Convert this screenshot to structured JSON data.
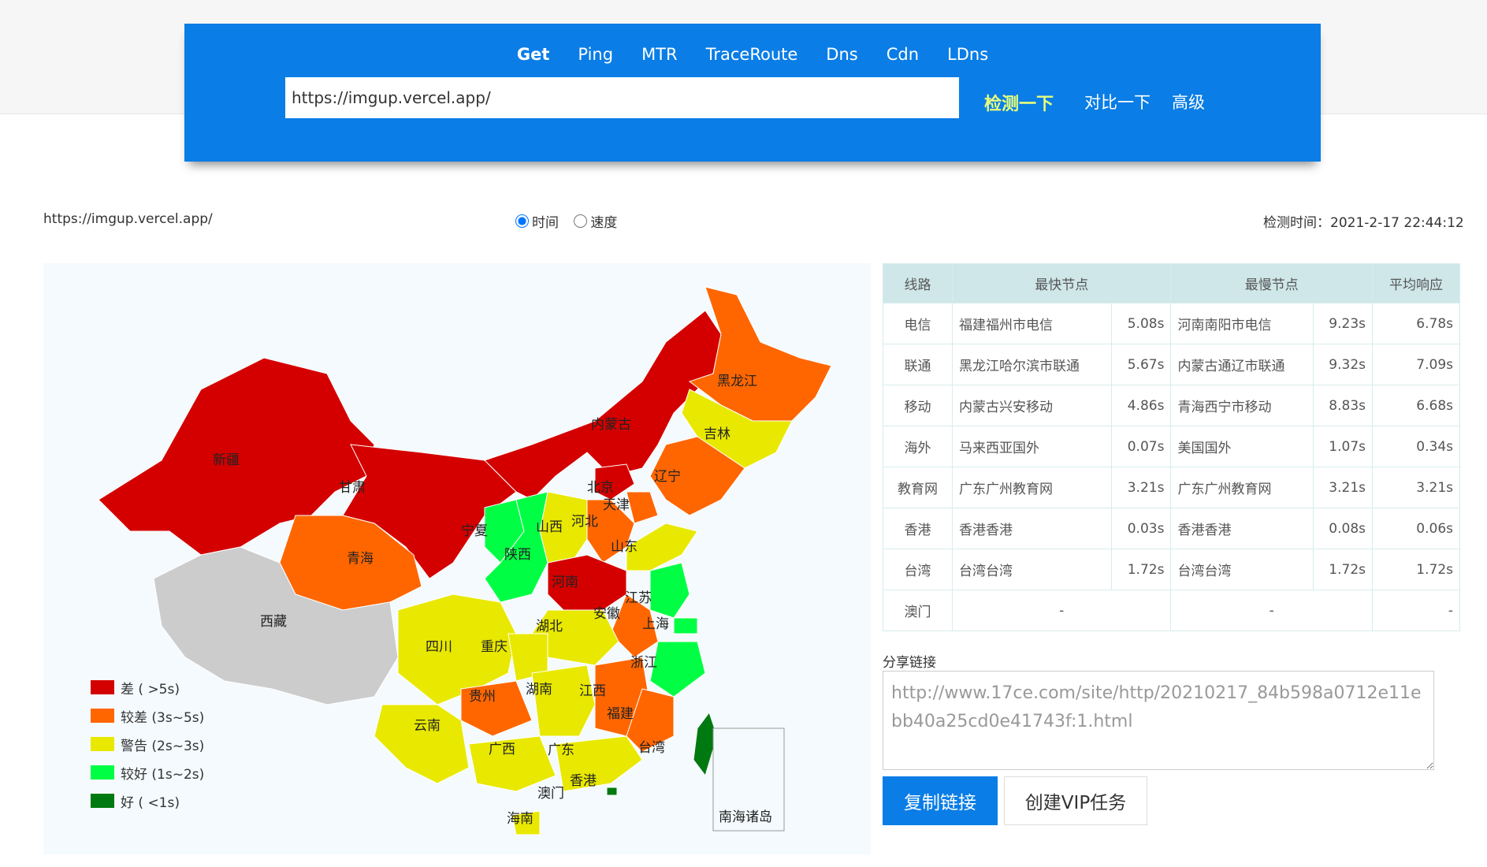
{
  "nav": {
    "tabs": [
      "Get",
      "Ping",
      "MTR",
      "TraceRoute",
      "Dns",
      "Cdn",
      "LDns"
    ],
    "active_tab": "Get",
    "url_value": "https://imgup.vercel.app/",
    "check_label": "检测一下",
    "compare_label": "对比一下",
    "advanced_label": "高级"
  },
  "info": {
    "url": "https://imgup.vercel.app/",
    "radio_time": "时间",
    "radio_speed": "速度",
    "check_time": "检测时间：2021-2-17 22:44:12"
  },
  "map": {
    "provinces": [
      "新疆",
      "甘肃",
      "青海",
      "西藏",
      "内蒙古",
      "黑龙江",
      "吉林",
      "辽宁",
      "北京",
      "天津",
      "河北",
      "山西",
      "宁夏",
      "陕西",
      "山东",
      "河南",
      "江苏",
      "上海",
      "安徽",
      "湖北",
      "四川",
      "重庆",
      "浙江",
      "贵州",
      "湖南",
      "江西",
      "云南",
      "福建",
      "台湾",
      "广西",
      "广东",
      "香港",
      "澳门",
      "海南",
      "南海诸岛"
    ],
    "legend": [
      {
        "label": "差 ( >5s)",
        "color": "#d40000"
      },
      {
        "label": "较差 (3s~5s)",
        "color": "#ff6600"
      },
      {
        "label": "警告 (2s~3s)",
        "color": "#e8e800"
      },
      {
        "label": "较好 (1s~2s)",
        "color": "#00ff44"
      },
      {
        "label": "好 ( <1s)",
        "color": "#007a10"
      }
    ]
  },
  "table": {
    "headers": [
      "线路",
      "最快节点",
      "最慢节点",
      "平均响应"
    ],
    "rows": [
      {
        "line": "电信",
        "fast": "福建福州市电信",
        "fast_t": "5.08s",
        "slow": "河南南阳市电信",
        "slow_t": "9.23s",
        "avg": "6.78s"
      },
      {
        "line": "联通",
        "fast": "黑龙江哈尔滨市联通",
        "fast_t": "5.67s",
        "slow": "内蒙古通辽市联通",
        "slow_t": "9.32s",
        "avg": "7.09s"
      },
      {
        "line": "移动",
        "fast": "内蒙古兴安移动",
        "fast_t": "4.86s",
        "slow": "青海西宁市移动",
        "slow_t": "8.83s",
        "avg": "6.68s"
      },
      {
        "line": "海外",
        "fast": "马来西亚国外",
        "fast_t": "0.07s",
        "slow": "美国国外",
        "slow_t": "1.07s",
        "avg": "0.34s"
      },
      {
        "line": "教育网",
        "fast": "广东广州教育网",
        "fast_t": "3.21s",
        "slow": "广东广州教育网",
        "slow_t": "3.21s",
        "avg": "3.21s"
      },
      {
        "line": "香港",
        "fast": "香港香港",
        "fast_t": "0.03s",
        "slow": "香港香港",
        "slow_t": "0.08s",
        "avg": "0.06s"
      },
      {
        "line": "台湾",
        "fast": "台湾台湾",
        "fast_t": "1.72s",
        "slow": "台湾台湾",
        "slow_t": "1.72s",
        "avg": "1.72s"
      },
      {
        "line": "澳门",
        "fast": "-",
        "fast_t": "",
        "slow": "-",
        "slow_t": "",
        "avg": "-"
      }
    ]
  },
  "share": {
    "label": "分享链接",
    "link": "http://www.17ce.com/site/http/20210217_84b598a0712e11ebb40a25cd0e41743f:1.html",
    "copy_button": "复制链接",
    "vip_button": "创建VIP任务"
  }
}
